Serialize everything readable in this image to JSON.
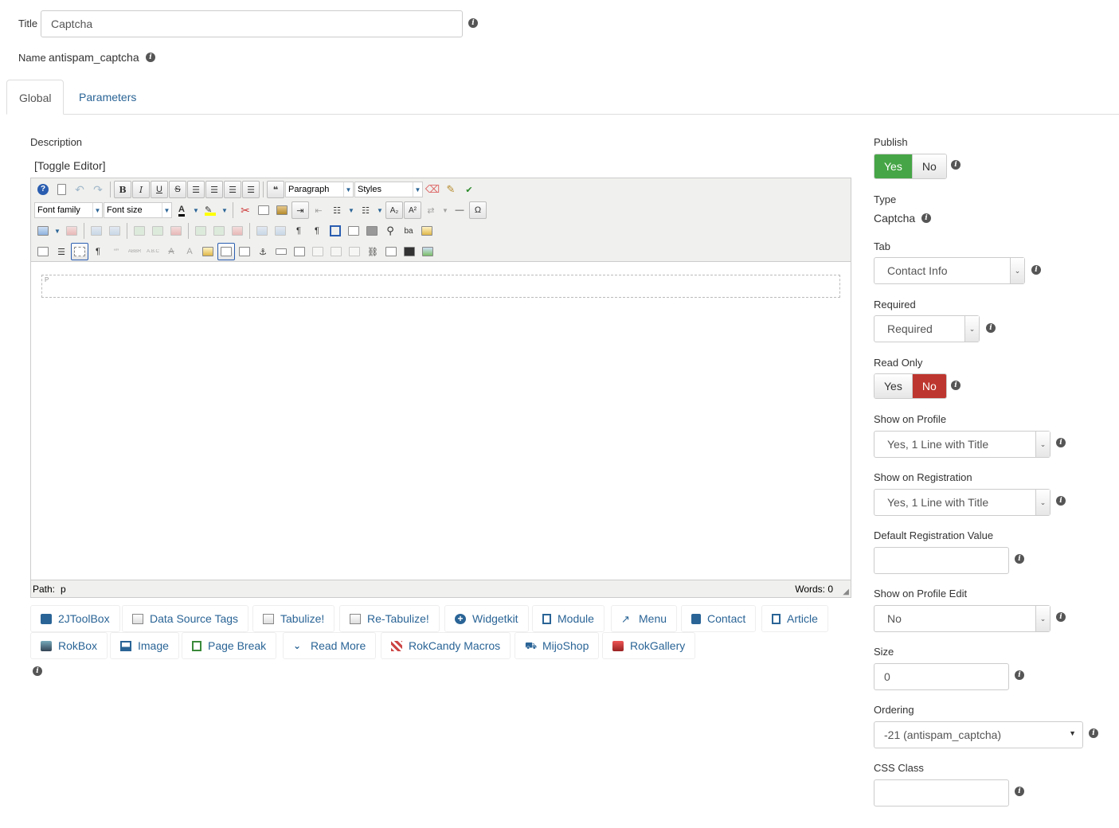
{
  "header": {
    "title_label": "Title",
    "title_value": "Captcha",
    "name_label": "Name",
    "name_value": "antispam_captcha"
  },
  "tabs": [
    {
      "label": "Global",
      "active": true
    },
    {
      "label": "Parameters",
      "active": false
    }
  ],
  "description_label": "Description",
  "toggle_editor": "[Toggle Editor]",
  "editor": {
    "format_select": "Paragraph",
    "styles_select": "Styles",
    "font_family_select": "Font family",
    "font_size_select": "Font size",
    "bold": "B",
    "italic": "I",
    "underline": "U",
    "strike": "S",
    "paragraph_marker": "P",
    "path_label": "Path:",
    "path_value": "p",
    "words_label": "Words: 0"
  },
  "extension_buttons": [
    {
      "label": "2JToolBox",
      "icon": "toolbox-icon"
    },
    {
      "label": "Data Source Tags",
      "icon": "tags-icon"
    },
    {
      "label": "Tabulize!",
      "icon": "tabulize-icon"
    },
    {
      "label": "Re-Tabulize!",
      "icon": "retabulize-icon"
    },
    {
      "label": "Widgetkit",
      "icon": "plus-circle-icon"
    },
    {
      "label": "Module",
      "icon": "file-add-icon"
    },
    {
      "label": "Menu",
      "icon": "share-icon"
    },
    {
      "label": "Contact",
      "icon": "address-book-icon"
    },
    {
      "label": "Article",
      "icon": "file-add-icon"
    },
    {
      "label": "RokBox",
      "icon": "rokbox-icon"
    },
    {
      "label": "Image",
      "icon": "picture-icon"
    },
    {
      "label": "Page Break",
      "icon": "copy-icon"
    },
    {
      "label": "Read More",
      "icon": "chevron-down-icon"
    },
    {
      "label": "RokCandy Macros",
      "icon": "rokcandy-icon"
    },
    {
      "label": "MijoShop",
      "icon": "cart-icon"
    },
    {
      "label": "RokGallery",
      "icon": "gallery-icon"
    }
  ],
  "sidebar": {
    "publish": {
      "label": "Publish",
      "yes": "Yes",
      "no": "No",
      "value": "Yes"
    },
    "type": {
      "label": "Type",
      "value": "Captcha"
    },
    "tab": {
      "label": "Tab",
      "value": "Contact Info"
    },
    "required": {
      "label": "Required",
      "value": "Required"
    },
    "read_only": {
      "label": "Read Only",
      "yes": "Yes",
      "no": "No",
      "value": "No"
    },
    "show_on_profile": {
      "label": "Show on Profile",
      "value": "Yes, 1 Line with Title"
    },
    "show_on_registration": {
      "label": "Show on Registration",
      "value": "Yes, 1 Line with Title"
    },
    "default_registration_value": {
      "label": "Default Registration Value",
      "value": ""
    },
    "show_on_profile_edit": {
      "label": "Show on Profile Edit",
      "value": "No"
    },
    "size": {
      "label": "Size",
      "value": "0"
    },
    "ordering": {
      "label": "Ordering",
      "value": "-21 (antispam_captcha)"
    },
    "css_class": {
      "label": "CSS Class",
      "value": ""
    }
  },
  "colors": {
    "link": "#2a6496",
    "yes_active": "#46a546",
    "no_active": "#bd362f"
  }
}
